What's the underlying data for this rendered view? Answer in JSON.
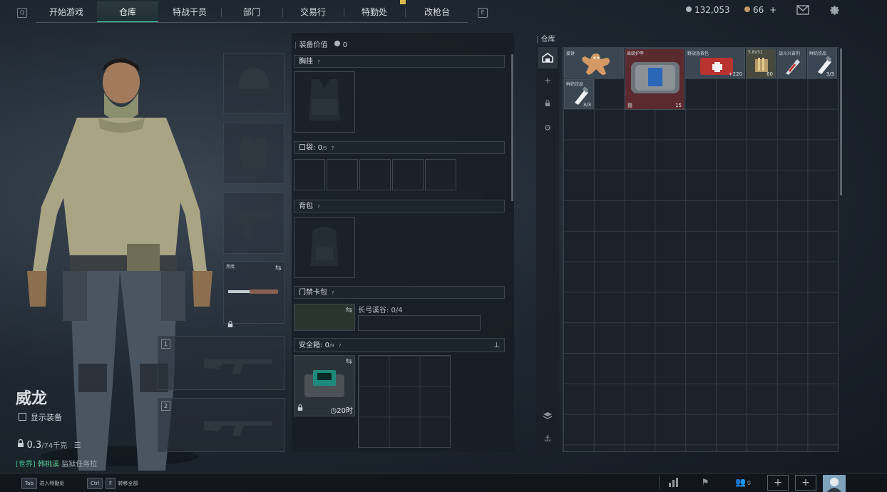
{
  "nav": {
    "tabs": [
      {
        "label": "开始游戏",
        "active": false
      },
      {
        "label": "仓库",
        "active": true
      },
      {
        "label": "特战干员",
        "active": false
      },
      {
        "label": "部门",
        "active": false
      },
      {
        "label": "交易行",
        "active": false
      },
      {
        "label": "特勤处",
        "active": false
      },
      {
        "label": "改枪台",
        "active": false
      }
    ],
    "key_left": "Q",
    "key_right": "E"
  },
  "header": {
    "silver_amount": "132,053",
    "gold_amount": "66",
    "add_label": "+"
  },
  "operator": {
    "name": "威龙",
    "show_equipment_label": "显示装备",
    "weight_value": "0.3",
    "weight_max": "/74千克",
    "chat_channel": "[世界]",
    "chat_user": "韩桃溪",
    "chat_text": "监狱任务拉"
  },
  "loadout_slots": {
    "melee_label": "黑鹰",
    "primary_index": "1",
    "secondary_index": "2"
  },
  "center": {
    "equip_value_label": "装备价值",
    "equip_value": "0",
    "chest_rig_label": "胸挂",
    "pocket_label": "口袋:",
    "pocket_count": "0",
    "pocket_max": "/5",
    "backpack_label": "背包",
    "keycard_label": "门禁卡包",
    "keycard_item_label": "长弓溪谷: 0/4",
    "safe_box_label": "安全箱:",
    "safe_box_count": "0",
    "safe_box_max": "/9",
    "safe_box_timer": "20时",
    "help": "?"
  },
  "warehouse": {
    "title": "仓库",
    "items": [
      {
        "name": "姜饼",
        "count": ""
      },
      {
        "name": "高级护甲",
        "count": "15"
      },
      {
        "name": "野战急救包",
        "count": "+220"
      },
      {
        "name": "5.8x51",
        "count": "60"
      },
      {
        "name": "战斗兴奋剂",
        "count": ""
      },
      {
        "name": "鲜奶饮品",
        "count": "3/3"
      },
      {
        "name": "鲜奶饮品",
        "count": "3/3"
      }
    ]
  },
  "bottom": {
    "tab_key": "Tab",
    "tab_label": "进入特勤处",
    "ctrl_key": "Ctrl",
    "f_key": "F",
    "transfer_label": "转移全部",
    "friends_count": "0"
  },
  "colors": {
    "accent": "#3dd6b0",
    "panel": "#171e25",
    "armor_bg": "#5a2a2e"
  }
}
